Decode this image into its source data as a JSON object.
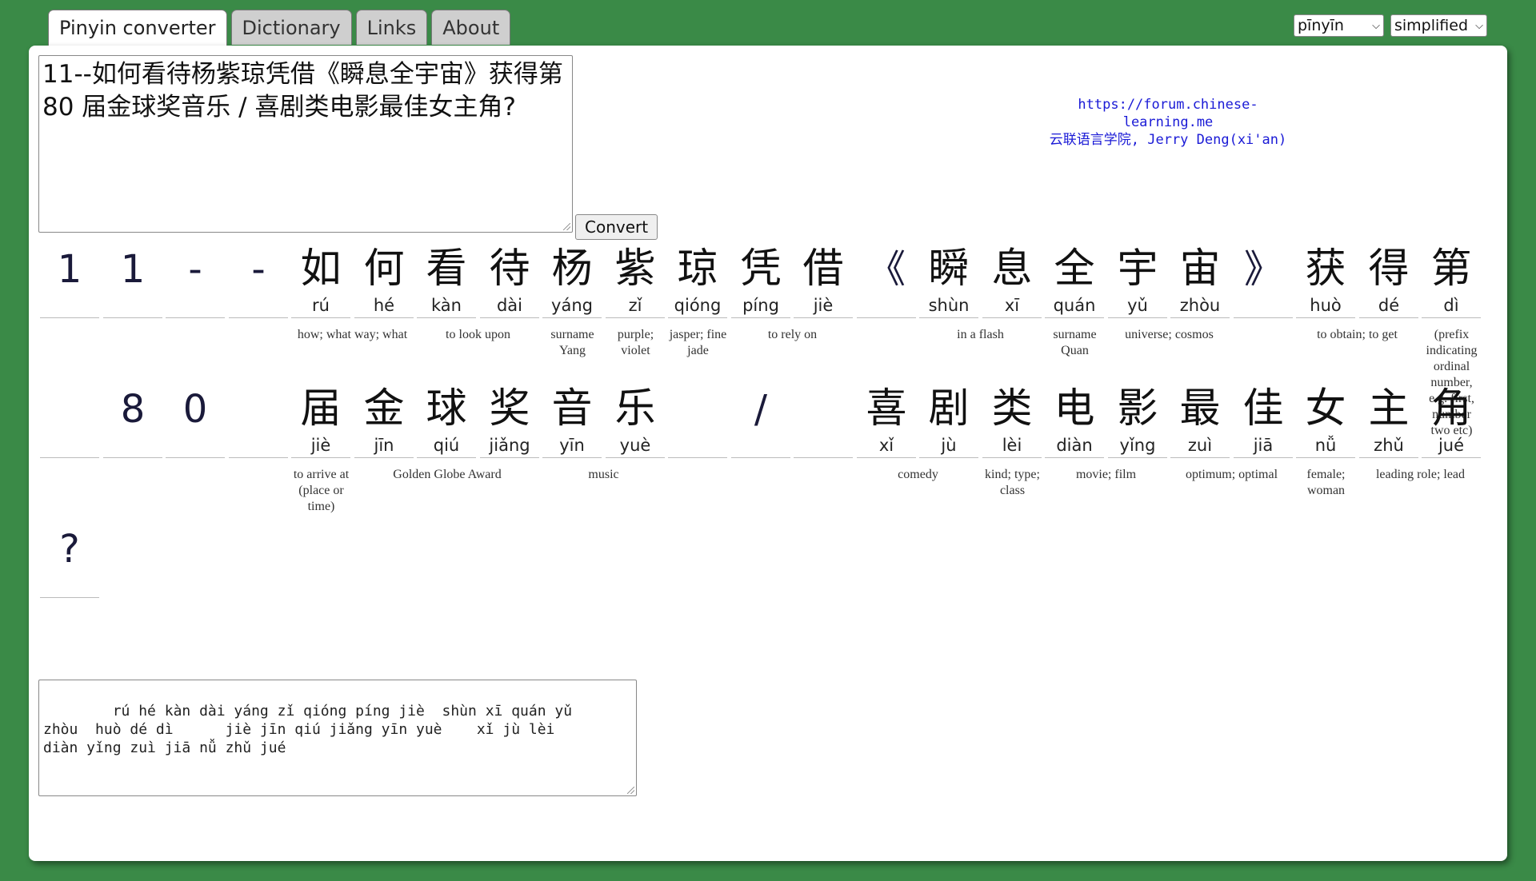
{
  "tabs": [
    "Pinyin converter",
    "Dictionary",
    "Links",
    "About"
  ],
  "selects": {
    "mode": "pīnyīn",
    "script": "simplified"
  },
  "input_text": "11--如何看待杨紫琼凭借《瞬息全宇宙》获得第 80 届金球奖音乐 / 喜剧类电影最佳女主角?",
  "convert_label": "Convert",
  "credit": {
    "url": "https://forum.chinese-learning.me",
    "line2": "云联语言学院, Jerry Deng(xi'an)"
  },
  "rows": [
    {
      "cells": [
        {
          "hz": "1",
          "py": ""
        },
        {
          "hz": "1",
          "py": ""
        },
        {
          "hz": "-",
          "py": ""
        },
        {
          "hz": "-",
          "py": ""
        },
        {
          "hz": "如",
          "py": "rú"
        },
        {
          "hz": "何",
          "py": "hé"
        },
        {
          "hz": "看",
          "py": "kàn"
        },
        {
          "hz": "待",
          "py": "dài"
        },
        {
          "hz": "杨",
          "py": "yáng"
        },
        {
          "hz": "紫",
          "py": "zǐ"
        },
        {
          "hz": "琼",
          "py": "qióng"
        },
        {
          "hz": "凭",
          "py": "píng"
        },
        {
          "hz": "借",
          "py": "jiè"
        },
        {
          "hz": "《",
          "py": ""
        },
        {
          "hz": "瞬",
          "py": "shùn"
        },
        {
          "hz": "息",
          "py": "xī"
        },
        {
          "hz": "全",
          "py": "quán"
        },
        {
          "hz": "宇",
          "py": "yǔ"
        },
        {
          "hz": "宙",
          "py": "zhòu"
        },
        {
          "hz": "》",
          "py": ""
        },
        {
          "hz": "获",
          "py": "huò"
        },
        {
          "hz": "得",
          "py": "dé"
        },
        {
          "hz": "第",
          "py": "dì"
        }
      ],
      "glosses": [
        {
          "text": "how; what way; what",
          "start": 4,
          "span": 2
        },
        {
          "text": "to look upon",
          "start": 6,
          "span": 2
        },
        {
          "text": "surname Yang",
          "start": 8,
          "span": 1
        },
        {
          "text": "purple; violet",
          "start": 9,
          "span": 1
        },
        {
          "text": "jasper; fine jade",
          "start": 10,
          "span": 1
        },
        {
          "text": "to rely on",
          "start": 11,
          "span": 2
        },
        {
          "text": "in a flash",
          "start": 14,
          "span": 2
        },
        {
          "text": "surname Quan",
          "start": 16,
          "span": 1
        },
        {
          "text": "universe; cosmos",
          "start": 17,
          "span": 2
        },
        {
          "text": "to obtain; to get",
          "start": 20,
          "span": 2
        },
        {
          "text": "(prefix indicating ordinal number, e.g. first, number two etc)",
          "start": 22,
          "span": 1
        }
      ]
    },
    {
      "cells": [
        {
          "hz": "",
          "py": ""
        },
        {
          "hz": "8",
          "py": ""
        },
        {
          "hz": "0",
          "py": ""
        },
        {
          "hz": "",
          "py": ""
        },
        {
          "hz": "届",
          "py": "jiè"
        },
        {
          "hz": "金",
          "py": "jīn"
        },
        {
          "hz": "球",
          "py": "qiú"
        },
        {
          "hz": "奖",
          "py": "jiǎng"
        },
        {
          "hz": "音",
          "py": "yīn"
        },
        {
          "hz": "乐",
          "py": "yuè"
        },
        {
          "hz": "",
          "py": ""
        },
        {
          "hz": "/",
          "py": ""
        },
        {
          "hz": "",
          "py": ""
        },
        {
          "hz": "喜",
          "py": "xǐ"
        },
        {
          "hz": "剧",
          "py": "jù"
        },
        {
          "hz": "类",
          "py": "lèi"
        },
        {
          "hz": "电",
          "py": "diàn"
        },
        {
          "hz": "影",
          "py": "yǐng"
        },
        {
          "hz": "最",
          "py": "zuì"
        },
        {
          "hz": "佳",
          "py": "jiā"
        },
        {
          "hz": "女",
          "py": "nǚ"
        },
        {
          "hz": "主",
          "py": "zhǔ"
        },
        {
          "hz": "角",
          "py": "jué"
        }
      ],
      "glosses": [
        {
          "text": "to arrive at (place or time)",
          "start": 4,
          "span": 1
        },
        {
          "text": "Golden Globe Award",
          "start": 5,
          "span": 3
        },
        {
          "text": "music",
          "start": 8,
          "span": 2
        },
        {
          "text": "comedy",
          "start": 13,
          "span": 2
        },
        {
          "text": "kind; type; class",
          "start": 15,
          "span": 1
        },
        {
          "text": "movie; film",
          "start": 16,
          "span": 2
        },
        {
          "text": "optimum; optimal",
          "start": 18,
          "span": 2
        },
        {
          "text": "female; woman",
          "start": 20,
          "span": 1
        },
        {
          "text": "leading role; lead",
          "start": 21,
          "span": 2
        }
      ]
    },
    {
      "cells": [
        {
          "hz": "?",
          "py": ""
        }
      ],
      "glosses": []
    }
  ],
  "output_text": "    rú hé kàn dài yáng zǐ qióng píng jiè  shùn xī quán yǔ\nzhòu  huò dé dì      jiè jīn qiú jiǎng yīn yuè    xǐ jù lèi\ndiàn yǐng zuì jiā nǚ zhǔ jué"
}
